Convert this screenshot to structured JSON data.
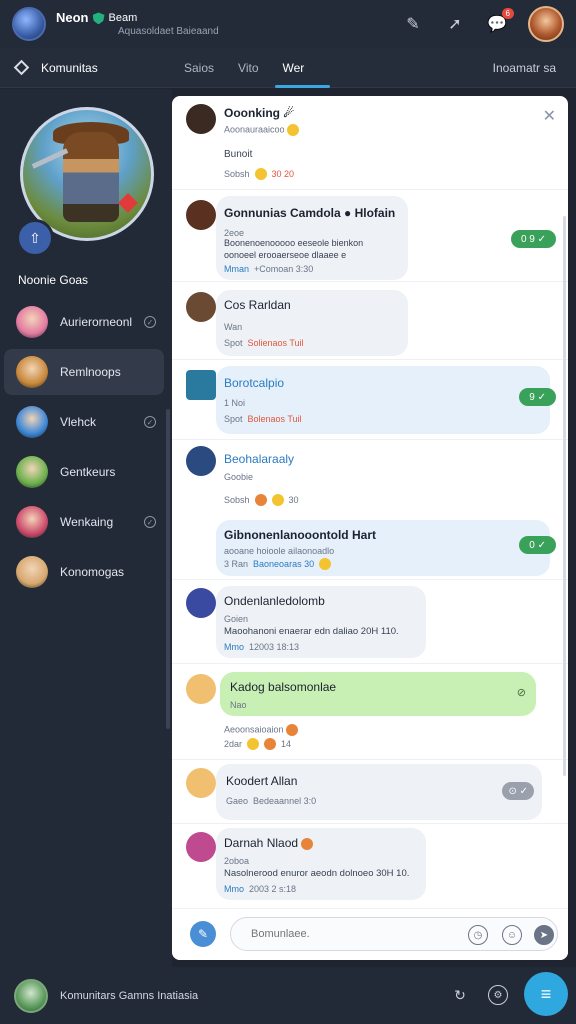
{
  "topbar": {
    "name": "Neon",
    "title": "Beam",
    "subtitle": "Aquasoldaet Baieaand",
    "notification_count": "6"
  },
  "tabs": {
    "brand": "Komunitas",
    "items": [
      "Saios",
      "Vito",
      "Wer"
    ],
    "active_index": 2,
    "right_label": "Inoamatr sa"
  },
  "sidebar": {
    "heading": "Noonie Goas",
    "items": [
      {
        "label": "Aurierorneonl",
        "avatar_color": "#e27aa0",
        "has_check": true
      },
      {
        "label": "Remlnoops",
        "avatar_color": "#c8883a",
        "has_check": false
      },
      {
        "label": "Vlehck",
        "avatar_color": "#3b86d6",
        "has_check": true
      },
      {
        "label": "Gentkeurs",
        "avatar_color": "#6ab04c",
        "has_check": false
      },
      {
        "label": "Wenkaing",
        "avatar_color": "#cc4a6a",
        "has_check": true
      },
      {
        "label": "Konomogas",
        "avatar_color": "#d7a86e",
        "has_check": false
      }
    ],
    "active_index": 1
  },
  "chat": {
    "messages": [
      {
        "title": "Ooonking ☄",
        "sub": "Aoonauraaicoo",
        "body": "Bunoit",
        "meta_label": "Sobsh",
        "meta_value": "30  20",
        "avatar_color": "#3a2a22"
      },
      {
        "title": "Gonnunias Camdola ● Hlofain",
        "sub": "2eoe",
        "body": "Boonenoenooooo eeseole bienkon",
        "body2": "oonoeel erooaerseoe dlaaee e",
        "meta_label": "Mman",
        "meta_value": "+Comoan 3:30",
        "pill": "0 9 ✓",
        "avatar_color": "#5a3020"
      },
      {
        "title": "Cos Rarldan",
        "sub": "Wan",
        "meta_label": "Spot",
        "meta_value": "Solienaos Tuil",
        "avatar_color": "#6b4a34"
      },
      {
        "title": "Borotcalpio",
        "sub": "1 Noi",
        "meta_label": "Spot",
        "meta_value": "Bolenaos Tuil",
        "pill": "9 ✓",
        "avatar_color": "#2a7aa0"
      },
      {
        "title": "Beohalaraaly",
        "sub": "Goobie",
        "meta_label": "Sobsh",
        "meta_value": "30",
        "avatar_color": "#2b4a80"
      },
      {
        "title": "Gibnonenlanooontold Hart",
        "sub": "aooane hoioole ailaonoadlo",
        "meta_label": "3 Ran",
        "meta_value": "Baoneoaras 30",
        "pill": "0 ✓",
        "avatar_color": "#4a9ad0"
      },
      {
        "title": "Ondenlanledolomb",
        "sub": "Goien",
        "body": "Maoohanoni enaerar edn daliao 20H 110.",
        "meta_label": "Mmo",
        "meta_value": "12003   18:13",
        "avatar_color": "#3a4aa0"
      },
      {
        "title": "Kadog balsomonlae",
        "sub": "Nao",
        "footer": "Aeoonsaioaion",
        "meta_label": "2dar",
        "meta_value": "14",
        "avatar_color": "#f0c070"
      },
      {
        "title": "Koodert Allan",
        "meta_label": "Gaeo",
        "meta_value": "Bedeaannel 3:0",
        "avatar_color": "#f0c070"
      },
      {
        "title": "Darnah Nlaod",
        "sub": "2oboa",
        "body": "Nasolnerood enuror aeodn dolnoeo 30H 10.",
        "meta_label": "Mmo",
        "meta_value": "2003 2   s:18",
        "avatar_color": "#c04a90"
      }
    ],
    "composer_placeholder": "Bomunlaee."
  },
  "bottombar": {
    "text": "Komunitars Gamns Inatiasia"
  },
  "colors": {
    "accent": "#2fa8e0",
    "online": "#3aa15a",
    "alert": "#e5483c"
  }
}
